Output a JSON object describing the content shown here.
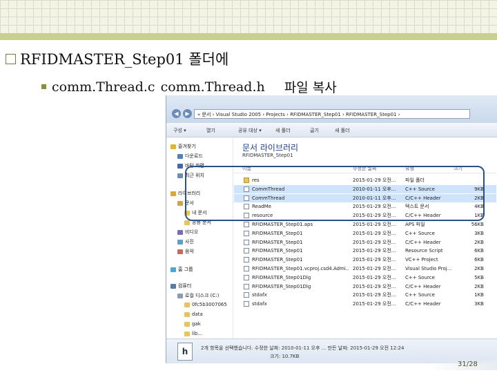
{
  "slide": {
    "heading": "RFIDMASTER_Step01 폴더에",
    "sub_left": "comm.Thread.c",
    "sub_mid": "comm.Thread.h",
    "sub_right": "파일 복사",
    "page": "31/28"
  },
  "explorer": {
    "address": "« 문서 › Visual Studio 2005 › Projects › RFIDMASTER_Step01 › RFIDMASTER_Step01 ›",
    "toolbar": [
      "구성 ▾",
      "열기",
      "공유 대상 ▾",
      "새 폴더",
      "굽기",
      "새 폴더"
    ],
    "nav": [
      {
        "label": "즐겨찾기",
        "indent": 0,
        "icon": "star-icon"
      },
      {
        "label": "다운로드",
        "indent": 1,
        "icon": "download-icon"
      },
      {
        "label": "바탕 화면",
        "indent": 1,
        "icon": "desktop-icon"
      },
      {
        "label": "최근 위치",
        "indent": 1,
        "icon": "recent-icon"
      },
      {
        "label": "라이브러리",
        "indent": 0,
        "icon": "library-icon"
      },
      {
        "label": "문서",
        "indent": 1,
        "icon": "document-icon"
      },
      {
        "label": "내 문서",
        "indent": 2,
        "icon": "folder-icon"
      },
      {
        "label": "공용 문서",
        "indent": 2,
        "icon": "folder-icon"
      },
      {
        "label": "비디오",
        "indent": 1,
        "icon": "video-icon"
      },
      {
        "label": "사진",
        "indent": 1,
        "icon": "picture-icon"
      },
      {
        "label": "음악",
        "indent": 1,
        "icon": "music-icon"
      },
      {
        "label": "홈 그룹",
        "indent": 0,
        "icon": "homegroup-icon"
      },
      {
        "label": "컴퓨터",
        "indent": 0,
        "icon": "computer-icon"
      },
      {
        "label": "로컬 디스크 (C:)",
        "indent": 1,
        "icon": "drive-icon"
      },
      {
        "label": "0fc5b3007065",
        "indent": 2,
        "icon": "folder-icon"
      },
      {
        "label": "data",
        "indent": 2,
        "icon": "folder-icon"
      },
      {
        "label": "gak",
        "indent": 2,
        "icon": "folder-icon"
      },
      {
        "label": "lib...",
        "indent": 2,
        "icon": "folder-icon"
      }
    ],
    "library_title": "문서 라이브러리",
    "library_sub": "RFIDMASTER_Step01",
    "columns": {
      "name": "이름",
      "date": "수정한 날짜",
      "type": "유형",
      "size": "크기"
    },
    "files": [
      {
        "name": "res",
        "date": "2015-01-29 오전...",
        "type": "파일 폴더",
        "size": "",
        "folder": true,
        "selected": false
      },
      {
        "name": "CommThread",
        "date": "2010-01-11 오후...",
        "type": "C++ Source",
        "size": "9KB",
        "folder": false,
        "selected": true
      },
      {
        "name": "CommThread",
        "date": "2010-01-11 오후...",
        "type": "C/C++ Header",
        "size": "2KB",
        "folder": false,
        "selected": true
      },
      {
        "name": "ReadMe",
        "date": "2015-01-29 오전...",
        "type": "텍스트 문서",
        "size": "4KB",
        "folder": false,
        "selected": false
      },
      {
        "name": "resource",
        "date": "2015-01-29 오전...",
        "type": "C/C++ Header",
        "size": "1KB",
        "folder": false,
        "selected": false
      },
      {
        "name": "RFIDMASTER_Step01.aps",
        "date": "2015-01-29 오전...",
        "type": "APS 파일",
        "size": "56KB",
        "folder": false,
        "selected": false
      },
      {
        "name": "RFIDMASTER_Step01",
        "date": "2015-01-29 오전...",
        "type": "C++ Source",
        "size": "3KB",
        "folder": false,
        "selected": false
      },
      {
        "name": "RFIDMASTER_Step01",
        "date": "2015-01-29 오전...",
        "type": "C/C++ Header",
        "size": "2KB",
        "folder": false,
        "selected": false
      },
      {
        "name": "RFIDMASTER_Step01",
        "date": "2015-01-29 오전...",
        "type": "Resource Script",
        "size": "6KB",
        "folder": false,
        "selected": false
      },
      {
        "name": "RFIDMASTER_Step01",
        "date": "2015-01-29 오전...",
        "type": "VC++ Project",
        "size": "6KB",
        "folder": false,
        "selected": false
      },
      {
        "name": "RFIDMASTER_Step01.vcproj.csd4.Admi...",
        "date": "2015-01-29 오전...",
        "type": "Visual Studio Proj...",
        "size": "2KB",
        "folder": false,
        "selected": false
      },
      {
        "name": "RFIDMASTER_Step01Dlg",
        "date": "2015-01-29 오전...",
        "type": "C++ Source",
        "size": "5KB",
        "folder": false,
        "selected": false
      },
      {
        "name": "RFIDMASTER_Step01Dlg",
        "date": "2015-01-29 오전...",
        "type": "C/C++ Header",
        "size": "2KB",
        "folder": false,
        "selected": false
      },
      {
        "name": "stdafx",
        "date": "2015-01-29 오전...",
        "type": "C++ Source",
        "size": "1KB",
        "folder": false,
        "selected": false
      },
      {
        "name": "stdafx",
        "date": "2015-01-29 오전...",
        "type": "C/C++ Header",
        "size": "3KB",
        "folder": false,
        "selected": false
      }
    ],
    "details_line1": "2개 항목을 선택했습니다. 수정한 날짜: 2010-01-11 오후 ... 만든 날짜: 2015-01-29 오전 12:24",
    "details_line2": "크기: 10.7KB",
    "details_icon": "h"
  }
}
